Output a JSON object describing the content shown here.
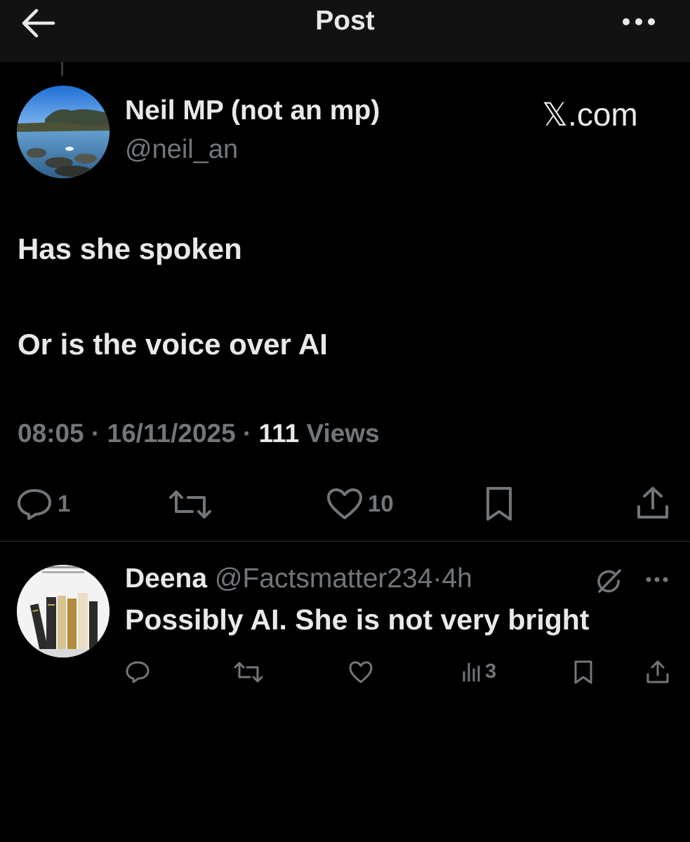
{
  "header": {
    "title": "Post",
    "back_icon": "arrow-left-icon",
    "more_icon": "more-horizontal-icon"
  },
  "post": {
    "author_name": "Neil MP (not an mp)",
    "author_handle": "@neil_an",
    "watermark": "𝕏.com",
    "lines": [
      "Has she spoken",
      "Or is the voice over AI"
    ],
    "time": "08:05",
    "date": "16/11/2025",
    "separator": "·",
    "views_count": "111",
    "views_label": "Views",
    "actions": {
      "reply_count": "1",
      "like_count": "10"
    }
  },
  "reply": {
    "author_name": "Deena",
    "author_handle": "@Factsmatter234",
    "separator": "·",
    "time": "4h",
    "text": "Possibly AI. She is not very bright",
    "views_count": "3"
  },
  "colors": {
    "background": "#000000",
    "header_background": "#121212",
    "text_primary": "#e7e9ea",
    "text_secondary": "#71767b",
    "divider": "#2f3336"
  }
}
